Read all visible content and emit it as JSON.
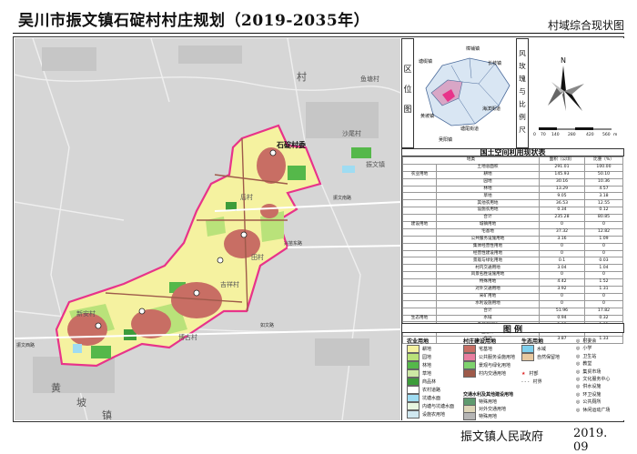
{
  "title": "吴川市振文镇石碇村村庄规划（2019-2035年）",
  "subtitle": "村域综合现状图",
  "footer": {
    "org": "振文镇人民政府",
    "date": "2019. 09"
  },
  "location": {
    "vertical_label": "区位图",
    "towns": [
      "塘缀镇",
      "樟铺镇",
      "长岐镇",
      "黄坡镇",
      "海滨街道",
      "塘尾街道",
      "吴阳镇"
    ]
  },
  "compass": {
    "vertical_label": "风玫瑰与比例尺",
    "north": "N",
    "scale_ticks": [
      "0",
      "70",
      "140",
      "280",
      "420",
      "560"
    ],
    "unit": "m"
  },
  "map": {
    "village_label": "石碇村委",
    "labels": [
      "沙尾村",
      "振文镇",
      "新安村",
      "吉祥村",
      "博古村",
      "鱼塘村",
      "黄",
      "坡",
      "镇",
      "村",
      "后村",
      "田村"
    ],
    "road_labels": [
      "兴苗东路",
      "振文南路",
      "振文西路",
      "如文路"
    ]
  },
  "table": {
    "title": "国土空间利用现状表",
    "headers": [
      "地类",
      "面积（公顷）",
      "比重（%）"
    ],
    "rows": [
      [
        "",
        "土地总面积",
        "291.01",
        "100.00"
      ],
      [
        "农业用地",
        "耕地",
        "145.93",
        "50.10"
      ],
      [
        "",
        "园地",
        "30.16",
        "10.36"
      ],
      [
        "",
        "林地",
        "13.29",
        "4.57"
      ],
      [
        "",
        "草地",
        "9.05",
        "3.18"
      ],
      [
        "",
        "其他农用地",
        "36.53",
        "12.55"
      ],
      [
        "",
        "设施农用地",
        "0.34",
        "0.12"
      ],
      [
        "",
        "合计",
        "235.28",
        "80.85"
      ],
      [
        "建设用地",
        "城镇用地",
        "0",
        "0"
      ],
      [
        "",
        "宅基地",
        "37.32",
        "12.82"
      ],
      [
        "",
        "公共服务设施用地",
        "3.16",
        "1.09"
      ],
      [
        "",
        "集体经营性用地",
        "0",
        "0"
      ],
      [
        "",
        "经营性建设用地",
        "0",
        "0"
      ],
      [
        "",
        "景观与绿化用地",
        "0.1",
        "0.03"
      ],
      [
        "",
        "村内交通用地",
        "3.04",
        "1.04"
      ],
      [
        "",
        "风景名胜设施用地",
        "0",
        "0"
      ],
      [
        "",
        "特殊用地",
        "4.42",
        "1.52"
      ],
      [
        "",
        "对外交通用地",
        "3.92",
        "1.31"
      ],
      [
        "",
        "采矿用地",
        "0",
        "0"
      ],
      [
        "",
        "水利设施用地",
        "0",
        "0"
      ],
      [
        "",
        "合计",
        "51.96",
        "17.82"
      ],
      [
        "生态用地",
        "水域",
        "0.94",
        "0.32"
      ],
      [
        "",
        "自然保留地",
        "2.93",
        "1.01"
      ],
      [
        "",
        "生态林",
        "0",
        "0"
      ],
      [
        "",
        "合计",
        "3.87",
        "1.33"
      ]
    ]
  },
  "legend": {
    "title": "图 例",
    "groups": {
      "agri": "农业用地",
      "build": "村庄建设用地",
      "eco": "生态用地",
      "transport": "交通水利及其他建设用地"
    },
    "agri_items": [
      {
        "label": "耕地",
        "color": "#f5f2a0"
      },
      {
        "label": "园地",
        "color": "#b9e27a"
      },
      {
        "label": "林地",
        "color": "#55b84a"
      },
      {
        "label": "草地",
        "color": "#cde8a5"
      },
      {
        "label": "商品林",
        "color": "#3c9c3a"
      },
      {
        "label": "农村道路",
        "color": "#ffffff"
      },
      {
        "label": "坑塘水面",
        "color": "#9fdcf2"
      },
      {
        "label": "内塘与坑塘水面",
        "color": "#e8f6e0"
      },
      {
        "label": "设施农用地",
        "color": "#d0e8f0"
      }
    ],
    "build_items": [
      {
        "label": "宅基地",
        "color": "#c86e64"
      },
      {
        "label": "公共服务设施用地",
        "color": "#e87ea0"
      },
      {
        "label": "景观与绿化用地",
        "color": "#7ed36e"
      },
      {
        "label": "村内交通用地",
        "color": "#9e5a4a"
      },
      {
        "label": "特殊用地",
        "color": "#5f9a6f"
      },
      {
        "label": "对外交通用地",
        "color": "#ddd5b8"
      },
      {
        "label": "特殊用地",
        "color": "#b5b5b5"
      }
    ],
    "eco_items": [
      {
        "label": "水域",
        "color": "#7ed0ee"
      },
      {
        "label": "自然保留地",
        "color": "#e8c9a0"
      }
    ],
    "line_items": [
      "村部",
      "村界"
    ],
    "facility_items": [
      "村委会",
      "小学",
      "卫生站",
      "教堂",
      "集贸市场",
      "文化服务中心",
      "供水设施",
      "环卫设施",
      "公共厕所",
      "休闲运动广场"
    ]
  },
  "colors": {
    "background": "#d8d8d8",
    "farmland": "#f5f2a0",
    "garden": "#b9e27a",
    "forest": "#55b84a",
    "homestead": "#c86e64",
    "boundary": "#e8338a",
    "water": "#9fdcf2"
  }
}
